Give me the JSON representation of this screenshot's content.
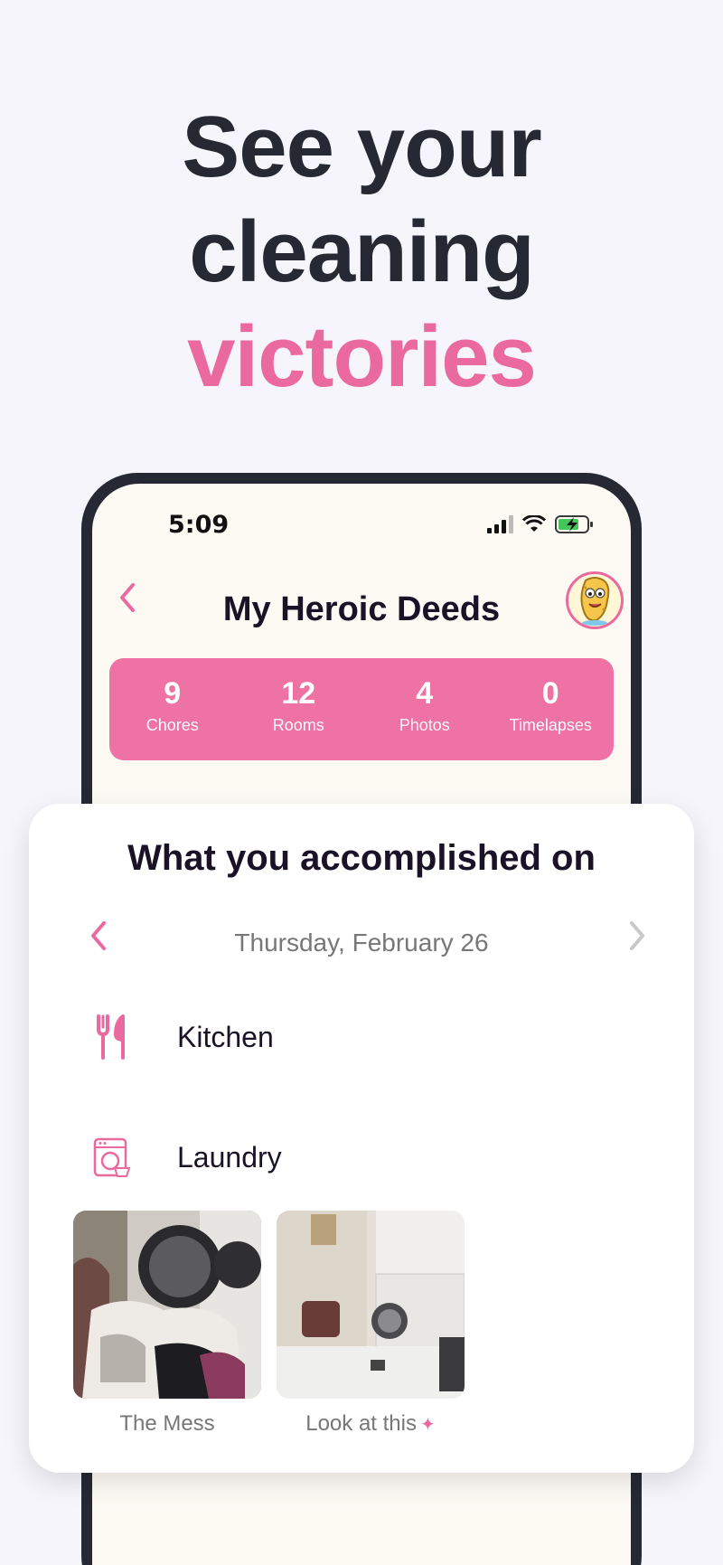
{
  "headline": {
    "line1": "See your",
    "line2": "cleaning",
    "line3": "victories"
  },
  "status_bar": {
    "time": "5:09"
  },
  "header": {
    "title": "My Heroic Deeds"
  },
  "stats": [
    {
      "value": "9",
      "label": "Chores"
    },
    {
      "value": "12",
      "label": "Rooms"
    },
    {
      "value": "4",
      "label": "Photos"
    },
    {
      "value": "0",
      "label": "Timelapses"
    }
  ],
  "card": {
    "title": "What you accomplished on",
    "date": "Thursday, February 26",
    "rooms": [
      {
        "name": "Kitchen",
        "icon": "fork-knife-icon"
      },
      {
        "name": "Laundry",
        "icon": "washing-machine-icon"
      }
    ],
    "photos": [
      {
        "caption": "The Mess"
      },
      {
        "caption": "Look at this"
      }
    ]
  },
  "colors": {
    "accent": "#ea6aa0",
    "headline": "#262833",
    "background": "#f6f5fb"
  }
}
